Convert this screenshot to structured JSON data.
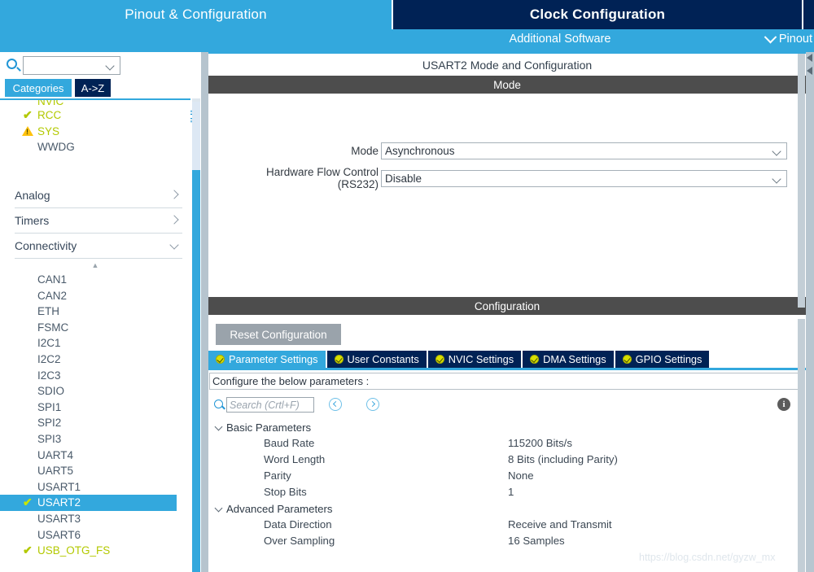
{
  "topbar": {
    "tabs": [
      {
        "label": "Pinout & Configuration",
        "active": true
      },
      {
        "label": "Clock Configuration",
        "active": false
      }
    ]
  },
  "subbar": {
    "additional_software": "Additional Software",
    "pinout_label": "Pinout",
    "chevron_icon": "chevron-down-icon"
  },
  "sidebar": {
    "search": {
      "value": "",
      "placeholder": ""
    },
    "gear_icon": "gear-icon",
    "category_tabs": [
      {
        "label": "Categories",
        "active": true
      },
      {
        "label": "A->Z",
        "active": false
      }
    ],
    "top_items": [
      {
        "label": "NVIC",
        "status": "none",
        "clipped": true
      },
      {
        "label": "RCC",
        "status": "check"
      },
      {
        "label": "SYS",
        "status": "warning"
      },
      {
        "label": "WWDG",
        "status": "none"
      }
    ],
    "groups": [
      {
        "label": "Analog",
        "expanded": false
      },
      {
        "label": "Timers",
        "expanded": false
      },
      {
        "label": "Connectivity",
        "expanded": true
      }
    ],
    "connectivity_items": [
      {
        "label": "CAN1",
        "status": "none",
        "selected": false
      },
      {
        "label": "CAN2",
        "status": "none",
        "selected": false
      },
      {
        "label": "ETH",
        "status": "none",
        "selected": false
      },
      {
        "label": "FSMC",
        "status": "none",
        "selected": false
      },
      {
        "label": "I2C1",
        "status": "none",
        "selected": false
      },
      {
        "label": "I2C2",
        "status": "none",
        "selected": false
      },
      {
        "label": "I2C3",
        "status": "none",
        "selected": false
      },
      {
        "label": "SDIO",
        "status": "none",
        "selected": false
      },
      {
        "label": "SPI1",
        "status": "none",
        "selected": false
      },
      {
        "label": "SPI2",
        "status": "none",
        "selected": false
      },
      {
        "label": "SPI3",
        "status": "none",
        "selected": false
      },
      {
        "label": "UART4",
        "status": "none",
        "selected": false
      },
      {
        "label": "UART5",
        "status": "none",
        "selected": false
      },
      {
        "label": "USART1",
        "status": "none",
        "selected": false
      },
      {
        "label": "USART2",
        "status": "check",
        "selected": true
      },
      {
        "label": "USART3",
        "status": "none",
        "selected": false
      },
      {
        "label": "USART6",
        "status": "none",
        "selected": false
      },
      {
        "label": "USB_OTG_FS",
        "status": "check",
        "selected": false
      }
    ]
  },
  "main": {
    "panel_title": "USART2 Mode and Configuration",
    "mode_band": "Mode",
    "mode_fields": [
      {
        "label": "Mode",
        "value": "Asynchronous"
      },
      {
        "label": "Hardware Flow Control (RS232)",
        "value": "Disable"
      }
    ],
    "config_band": "Configuration",
    "reset_button": "Reset Configuration",
    "config_tabs": [
      {
        "label": "Parameter Settings",
        "active": true
      },
      {
        "label": "User Constants",
        "active": false
      },
      {
        "label": "NVIC Settings",
        "active": false
      },
      {
        "label": "DMA Settings",
        "active": false
      },
      {
        "label": "GPIO Settings",
        "active": false
      }
    ],
    "config_hint": "Configure the below parameters :",
    "param_search": {
      "value": "",
      "placeholder": "Search (Crtl+F)"
    },
    "prev_icon": "chevron-left-circle-icon",
    "next_icon": "chevron-right-circle-icon",
    "info_icon": "info-icon",
    "param_groups": [
      {
        "label": "Basic Parameters",
        "expanded": true,
        "rows": [
          {
            "name": "Baud Rate",
            "value": "115200 Bits/s"
          },
          {
            "name": "Word Length",
            "value": "8 Bits (including Parity)"
          },
          {
            "name": "Parity",
            "value": "None"
          },
          {
            "name": "Stop Bits",
            "value": "1"
          }
        ]
      },
      {
        "label": "Advanced Parameters",
        "expanded": true,
        "rows": [
          {
            "name": "Data Direction",
            "value": "Receive and Transmit"
          },
          {
            "name": "Over Sampling",
            "value": "16 Samples"
          }
        ]
      }
    ]
  },
  "watermark": "https://blog.csdn.net/gyzw_mx",
  "colors": {
    "accent_blue": "#33a8dd",
    "dark_navy": "#002255",
    "band_gray": "#4d4d4d",
    "status_green": "#b3c900",
    "status_warning": "#ffc20e"
  }
}
